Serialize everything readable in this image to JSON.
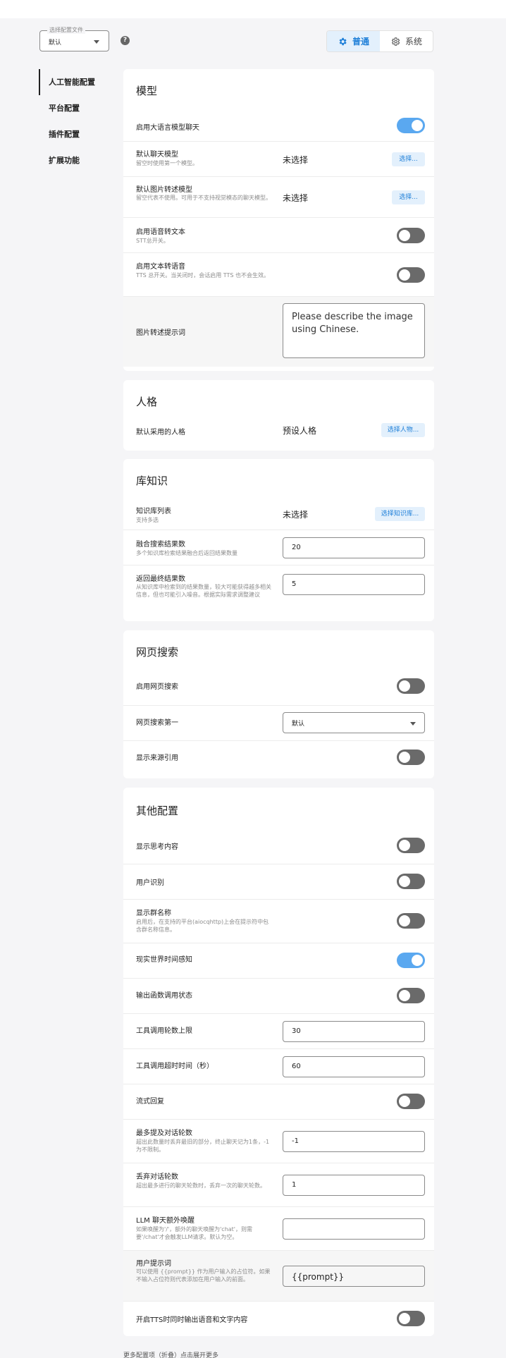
{
  "profile": {
    "legend": "选择配置文件",
    "value": "默认"
  },
  "help_icon": "?",
  "modes": [
    {
      "label": "普通",
      "icon": "gear-filled-icon",
      "active": true
    },
    {
      "label": "系统",
      "icon": "gear-outline-icon",
      "active": false
    }
  ],
  "nav": [
    "人工智能配置",
    "平台配置",
    "插件配置",
    "扩展功能"
  ],
  "model": {
    "title": "模型",
    "enable_llm": {
      "label": "启用大语言模型聊天",
      "on": true
    },
    "default_chat_model": {
      "label": "默认聊天模型",
      "desc": "留空时使用第一个模型。",
      "value": "未选择",
      "button": "选择..."
    },
    "default_image_model": {
      "label": "默认图片转述模型",
      "desc": "留空代表不使用。可用于不支持视觉模态的聊天模型。",
      "value": "未选择",
      "button": "选择..."
    },
    "enable_stt": {
      "label": "启用语音转文本",
      "desc": "STT总开关。",
      "on": false
    },
    "enable_tts": {
      "label": "启用文本转语音",
      "desc": "TTS 总开关。当关闭时，会话启用 TTS 也不会生效。",
      "on": false
    },
    "image_prompt": {
      "label": "图片转述提示词",
      "value": "Please describe the image using Chinese."
    }
  },
  "persona": {
    "title": "人格",
    "default_persona": {
      "label": "默认采用的人格",
      "value": "预设人格",
      "button": "选择人物..."
    }
  },
  "knowledge": {
    "title": "库知识",
    "kb_list": {
      "label": "知识库列表",
      "desc": "支持多选",
      "value": "未选择",
      "button": "选择知识库..."
    },
    "fusion_count": {
      "label": "融合搜索结果数",
      "desc": "多个知识库检索结果融合后返回结果数量",
      "value": "20"
    },
    "final_count": {
      "label": "返回最终结果数",
      "desc": "从知识库中检索到的结果数量，较大可能获得越多相关信息，但也可能引入噪音。根据实际需求调整建议",
      "value": "5"
    }
  },
  "websearch": {
    "title": "网页搜索",
    "enable": {
      "label": "启用网页搜索",
      "on": false
    },
    "provider": {
      "label": "网页搜索第一",
      "value": "默认"
    },
    "show_source": {
      "label": "显示来源引用",
      "on": false
    }
  },
  "other": {
    "title": "其他配置",
    "show_thinking": {
      "label": "显示思考内容",
      "on": false
    },
    "user_identify": {
      "label": "用户识别",
      "on": false
    },
    "show_group_name": {
      "label": "显示群名称",
      "desc": "启用后，在支持的平台(aiocqhttp)上会在提示符中包含群名称信息。",
      "on": false
    },
    "time_awareness": {
      "label": "现实世界时间感知",
      "on": true
    },
    "output_tool_status": {
      "label": "输出函数调用状态",
      "on": false
    },
    "tool_max_rounds": {
      "label": "工具调用轮数上限",
      "value": "30"
    },
    "tool_timeout": {
      "label": "工具调用超时时间（秒）",
      "value": "60"
    },
    "streaming": {
      "label": "流式回复",
      "on": false
    },
    "max_context": {
      "label": "最多提及对话轮数",
      "desc": "超出此数量时丢弃最旧的部分，终止聊天记为1条，-1为不限制。",
      "value": "-1"
    },
    "discard_rounds": {
      "label": "丢弃对话轮数",
      "desc": "超出最多进行的聊天轮数时，丢弃一次的聊天轮数。",
      "value": "1"
    },
    "extra_wake": {
      "label": "LLM 聊天额外唤醒",
      "desc": "如果唤醒为'/'，额外的聊天唤醒为'chat'，则需要'/chat'才会触发LLM请求。默认为空。",
      "value": ""
    },
    "user_prompt": {
      "label": "用户提示词",
      "desc": "可以使用 {{prompt}} 作为用户输入的占位符。如果不输入占位符则代表添加在用户输入的前面。",
      "value": "{{prompt}}"
    },
    "tts_dual": {
      "label": "开启TTS时同时输出语音和文字内容",
      "on": false
    }
  },
  "footer": "更多配置项（折叠）点击展开更多"
}
